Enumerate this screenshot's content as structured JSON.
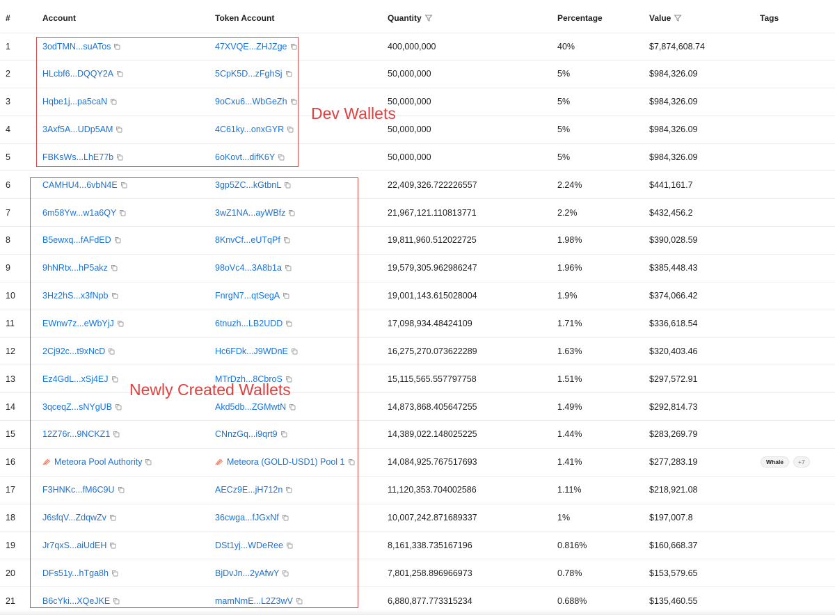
{
  "table": {
    "headers": {
      "index": "#",
      "account": "Account",
      "token_account": "Token Account",
      "quantity": "Quantity",
      "percentage": "Percentage",
      "value": "Value",
      "tags": "Tags"
    },
    "rows": [
      {
        "index": "1",
        "account": "3odTMN...suATos",
        "token_account": "47XVQE...ZHJZge",
        "quantity": "400,000,000",
        "percentage": "40%",
        "value": "$7,874,608.74"
      },
      {
        "index": "2",
        "account": "HLcbf6...DQQY2A",
        "token_account": "5CpK5D...zFghSj",
        "quantity": "50,000,000",
        "percentage": "5%",
        "value": "$984,326.09"
      },
      {
        "index": "3",
        "account": "Hqbe1j...pa5caN",
        "token_account": "9oCxu6...WbGeZh",
        "quantity": "50,000,000",
        "percentage": "5%",
        "value": "$984,326.09"
      },
      {
        "index": "4",
        "account": "3Axf5A...UDp5AM",
        "token_account": "4C61ky...onxGYR",
        "quantity": "50,000,000",
        "percentage": "5%",
        "value": "$984,326.09"
      },
      {
        "index": "5",
        "account": "FBKsWs...LhE77b",
        "token_account": "6oKovt...difK6Y",
        "quantity": "50,000,000",
        "percentage": "5%",
        "value": "$984,326.09"
      },
      {
        "index": "6",
        "account": "CAMHU4...6vbN4E",
        "token_account": "3gp5ZC...kGtbnL",
        "quantity": "22,409,326.722226557",
        "percentage": "2.24%",
        "value": "$441,161.7"
      },
      {
        "index": "7",
        "account": "6m58Yw...w1a6QY",
        "token_account": "3wZ1NA...ayWBfz",
        "quantity": "21,967,121.110813771",
        "percentage": "2.2%",
        "value": "$432,456.2"
      },
      {
        "index": "8",
        "account": "B5ewxq...fAFdED",
        "token_account": "8KnvCf...eUTqPf",
        "quantity": "19,811,960.512022725",
        "percentage": "1.98%",
        "value": "$390,028.59"
      },
      {
        "index": "9",
        "account": "9hNRtx...hP5akz",
        "token_account": "98oVc4...3A8b1a",
        "quantity": "19,579,305.962986247",
        "percentage": "1.96%",
        "value": "$385,448.43"
      },
      {
        "index": "10",
        "account": "3Hz2hS...x3fNpb",
        "token_account": "FnrgN7...qtSegA",
        "quantity": "19,001,143.615028004",
        "percentage": "1.9%",
        "value": "$374,066.42"
      },
      {
        "index": "11",
        "account": "EWnw7z...eWbYjJ",
        "token_account": "6tnuzh...LB2UDD",
        "quantity": "17,098,934.48424109",
        "percentage": "1.71%",
        "value": "$336,618.54"
      },
      {
        "index": "12",
        "account": "2Cj92c...t9xNcD",
        "token_account": "Hc6FDk...J9WDnE",
        "quantity": "16,275,270.073622289",
        "percentage": "1.63%",
        "value": "$320,403.46"
      },
      {
        "index": "13",
        "account": "Ez4GdL...xSj4EJ",
        "token_account": "MTrDzh...8CbroS",
        "quantity": "15,115,565.557797758",
        "percentage": "1.51%",
        "value": "$297,572.91"
      },
      {
        "index": "14",
        "account": "3qceqZ...sNYgUB",
        "token_account": "Akd5db...ZGMwtN",
        "quantity": "14,873,868.405647255",
        "percentage": "1.49%",
        "value": "$292,814.73"
      },
      {
        "index": "15",
        "account": "12Z76r...9NCKZ1",
        "token_account": "CNnzGq...i9qrt9",
        "quantity": "14,389,022.148025225",
        "percentage": "1.44%",
        "value": "$283,269.79"
      },
      {
        "index": "16",
        "account": "Meteora Pool Authority",
        "token_account": "Meteora (GOLD-USD1) Pool 1",
        "quantity": "14,084,925.767517693",
        "percentage": "1.41%",
        "value": "$277,283.19",
        "meteora": true,
        "tags": [
          "Whale",
          "+7"
        ]
      },
      {
        "index": "17",
        "account": "F3HNKc...fM6C9U",
        "token_account": "AECz9E...jH712n",
        "quantity": "11,120,353.704002586",
        "percentage": "1.11%",
        "value": "$218,921.08"
      },
      {
        "index": "18",
        "account": "J6sfqV...ZdqwZv",
        "token_account": "36cwga...fJGxNf",
        "quantity": "10,007,242.871689337",
        "percentage": "1%",
        "value": "$197,007.8"
      },
      {
        "index": "19",
        "account": "Jr7qxS...aiUdEH",
        "token_account": "DSt1yj...WDeRee",
        "quantity": "8,161,338.735167196",
        "percentage": "0.816%",
        "value": "$160,668.37"
      },
      {
        "index": "20",
        "account": "DFs51y...hTga8h",
        "token_account": "BjDvJn...2yAfwY",
        "quantity": "7,801,258.896966973",
        "percentage": "0.78%",
        "value": "$153,579.65"
      },
      {
        "index": "21",
        "account": "B6cYki...XQeJKE",
        "token_account": "mamNmE...L2Z3wV",
        "quantity": "6,880,877.773315234",
        "percentage": "0.688%",
        "value": "$135,460.55"
      }
    ]
  },
  "annotations": {
    "dev_wallets": "Dev Wallets",
    "newly_created": "Newly Created Wallets"
  },
  "icons": {
    "copy": "copy-icon",
    "filter": "filter-icon",
    "meteora": "meteora-icon"
  },
  "colors": {
    "link": "#1a73d9",
    "annotation": "#e24b4b",
    "row_border": "#ececec"
  }
}
